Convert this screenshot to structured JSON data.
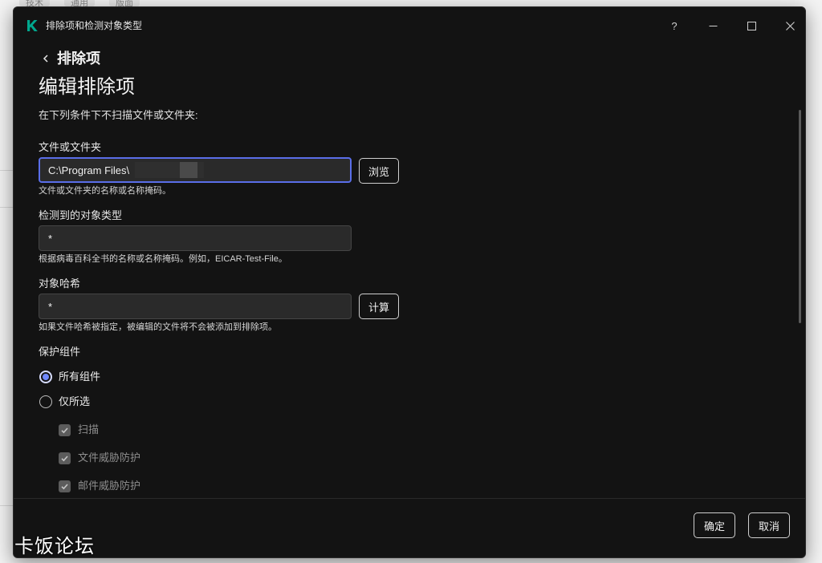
{
  "background_app": {
    "tabs": [
      "技术",
      "通用",
      "版面"
    ]
  },
  "window": {
    "title": "排除项和检测对象类型",
    "controls": {
      "help": "?"
    },
    "brand_color": "#00a88e"
  },
  "page": {
    "back_label": "排除项",
    "title": "编辑排除项",
    "description": "在下列条件下不扫描文件或文件夹:"
  },
  "fields": {
    "file_or_folder": {
      "label": "文件或文件夹",
      "value": "C:\\Program Files\\",
      "hint": "文件或文件夹的名称或名称掩码。",
      "browse_label": "浏览"
    },
    "object_type": {
      "label": "检测到的对象类型",
      "value": "*",
      "hint": "根据病毒百科全书的名称或名称掩码。例如，EICAR-Test-File。"
    },
    "object_hash": {
      "label": "对象哈希",
      "value": "*",
      "hint": "如果文件哈希被指定，被编辑的文件将不会被添加到排除项。",
      "calculate_label": "计算"
    }
  },
  "protection": {
    "label": "保护组件",
    "options": [
      {
        "label": "所有组件",
        "selected": true
      },
      {
        "label": "仅所选",
        "selected": false
      }
    ],
    "components": [
      {
        "label": "扫描",
        "checked": true
      },
      {
        "label": "文件威胁防护",
        "checked": true
      },
      {
        "label": "邮件威胁防护",
        "checked": true
      }
    ]
  },
  "footer": {
    "ok_label": "确定",
    "cancel_label": "取消"
  },
  "watermark": "卡饭论坛",
  "colors": {
    "accent": "#5a6ee8",
    "radio_dot": "#6f88ff",
    "window_bg": "#131313"
  }
}
